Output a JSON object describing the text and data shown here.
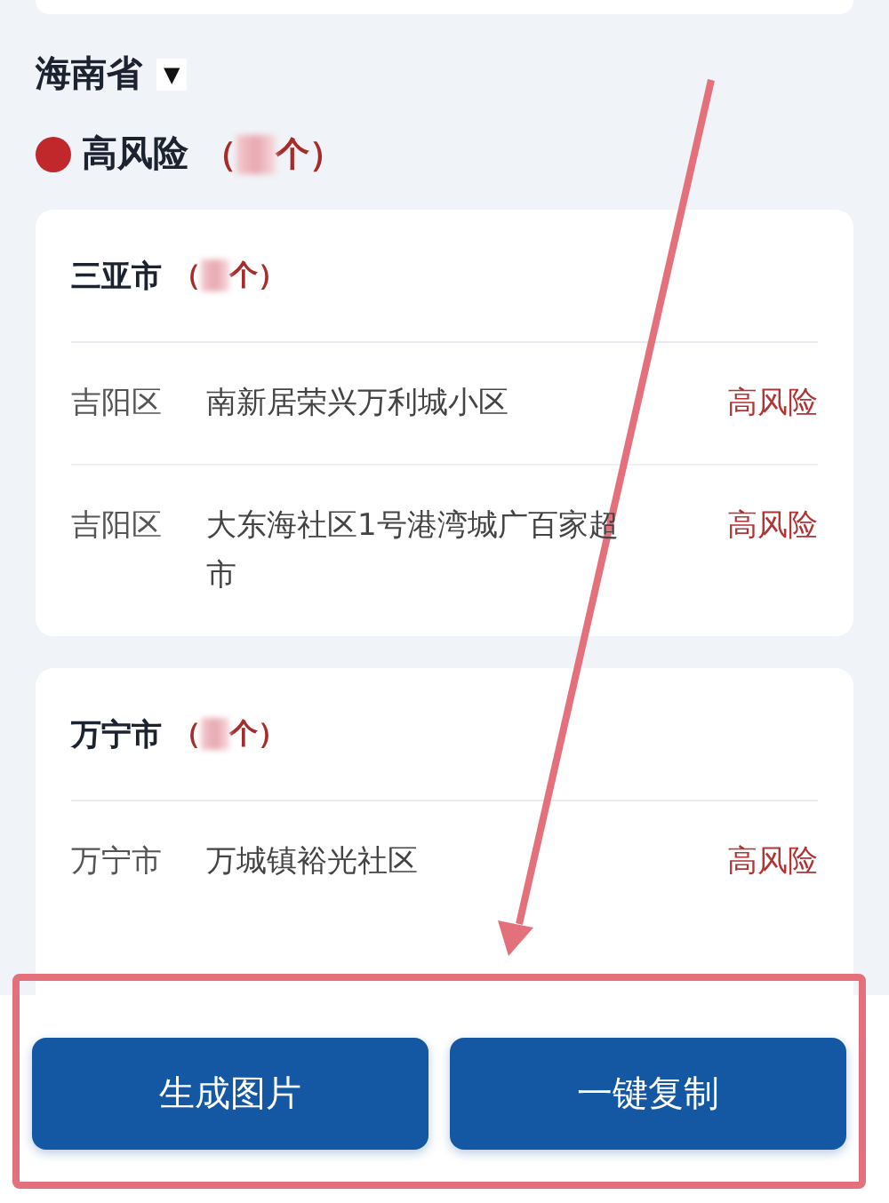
{
  "province": {
    "name": "海南省",
    "dropdown": "▼"
  },
  "risk_group": {
    "color": "#c0282b",
    "label": "高风险",
    "count_open": "（",
    "count_close": "个）"
  },
  "cities": [
    {
      "name": "三亚市",
      "count_open": "（",
      "count_close": "个）",
      "rows": [
        {
          "district": "吉阳区",
          "place": "南新居荣兴万利城小区",
          "risk": "高风险"
        },
        {
          "district": "吉阳区",
          "place": "大东海社区1号港湾城广百家超市",
          "risk": "高风险"
        }
      ]
    },
    {
      "name": "万宁市",
      "count_open": "（",
      "count_close": "个）",
      "rows": [
        {
          "district": "万宁市",
          "place": "万城镇裕光社区",
          "risk": "高风险"
        }
      ]
    }
  ],
  "buttons": [
    "生成图片",
    "一键复制"
  ]
}
